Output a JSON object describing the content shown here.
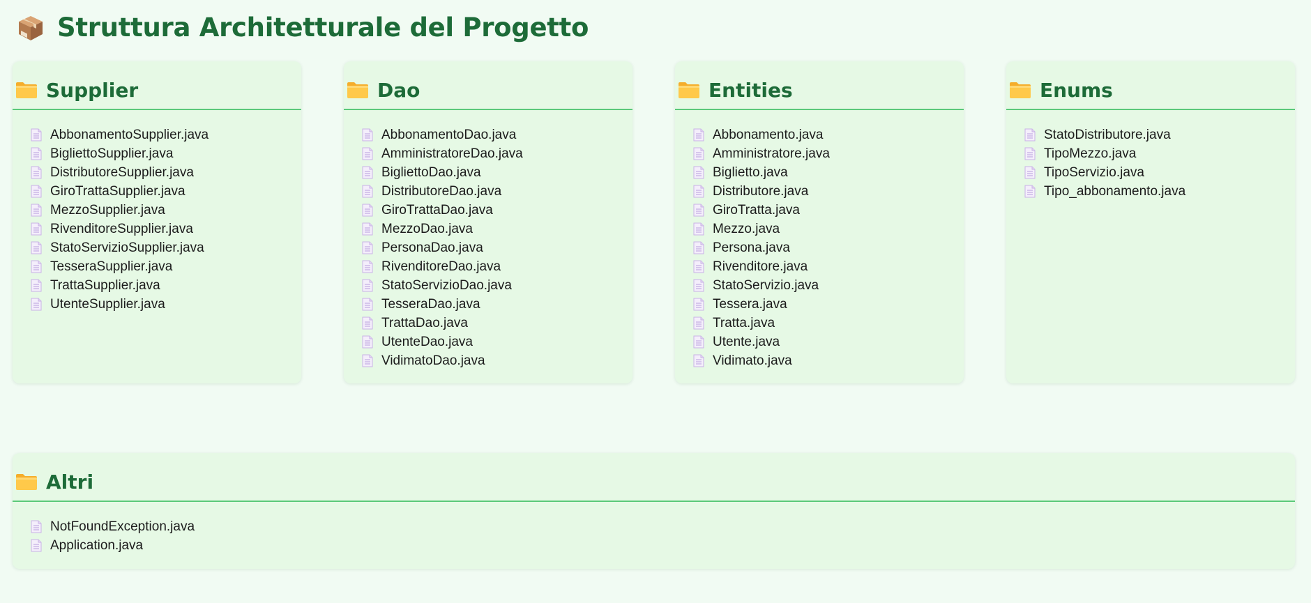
{
  "page": {
    "title": "Struttura Architetturale del Progetto",
    "title_icon": "package-icon"
  },
  "folders": [
    {
      "name": "Supplier",
      "icon": "folder-icon",
      "files": [
        "AbbonamentoSupplier.java",
        "BigliettoSupplier.java",
        "DistributoreSupplier.java",
        "GiroTrattaSupplier.java",
        "MezzoSupplier.java",
        "RivenditoreSupplier.java",
        "StatoServizioSupplier.java",
        "TesseraSupplier.java",
        "TrattaSupplier.java",
        "UtenteSupplier.java"
      ]
    },
    {
      "name": "Dao",
      "icon": "folder-icon",
      "files": [
        "AbbonamentoDao.java",
        "AmministratoreDao.java",
        "BigliettoDao.java",
        "DistributoreDao.java",
        "GiroTrattaDao.java",
        "MezzoDao.java",
        "PersonaDao.java",
        "RivenditoreDao.java",
        "StatoServizioDao.java",
        "TesseraDao.java",
        "TrattaDao.java",
        "UtenteDao.java",
        "VidimatoDao.java"
      ]
    },
    {
      "name": "Entities",
      "icon": "folder-icon",
      "files": [
        "Abbonamento.java",
        "Amministratore.java",
        "Biglietto.java",
        "Distributore.java",
        "GiroTratta.java",
        "Mezzo.java",
        "Persona.java",
        "Rivenditore.java",
        "StatoServizio.java",
        "Tessera.java",
        "Tratta.java",
        "Utente.java",
        "Vidimato.java"
      ]
    },
    {
      "name": "Enums",
      "icon": "folder-icon",
      "files": [
        "StatoDistributore.java",
        "TipoMezzo.java",
        "TipoServizio.java",
        "Tipo_abbonamento.java"
      ]
    },
    {
      "name": "Altri",
      "icon": "folder-icon",
      "files": [
        "NotFoundException.java",
        "Application.java"
      ]
    }
  ],
  "colors": {
    "background": "#f1fbf3",
    "card": "#e6f9e5",
    "heading": "#1d6b38",
    "divider": "#5bc97a",
    "folder": "#ffc94a",
    "file_icon": "#c9b3e6"
  }
}
